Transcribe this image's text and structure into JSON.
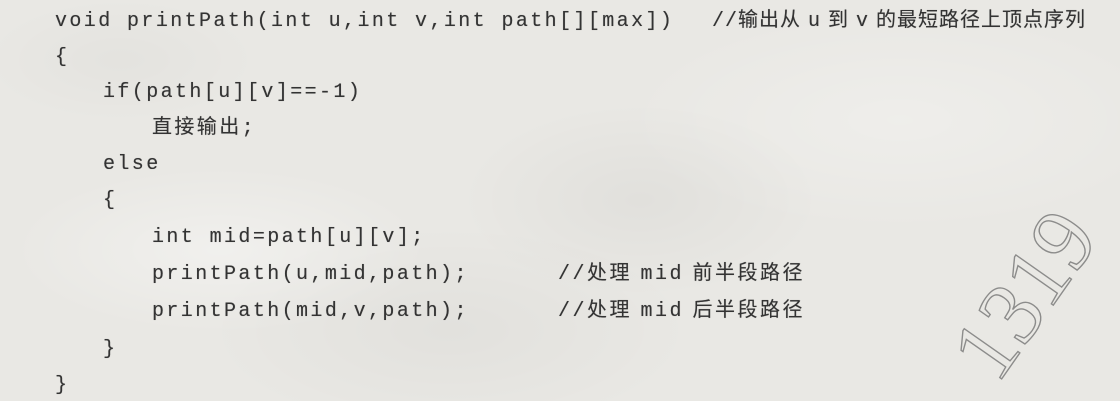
{
  "code_listing": {
    "lines": [
      {
        "code": "void printPath(int u,int v,int path[][max])",
        "comment": "//输出从 u 到 v 的最短路径上顶点序列"
      },
      {
        "code": "{"
      },
      {
        "code": "if(path[u][v]==-1)"
      },
      {
        "code": "直接输出;"
      },
      {
        "code": "else"
      },
      {
        "code": "{"
      },
      {
        "code": "int mid=path[u][v];"
      },
      {
        "code": "printPath(u,mid,path);",
        "comment": "//处理 mid 前半段路径"
      },
      {
        "code": "printPath(mid,v,path);",
        "comment": "//处理 mid 后半段路径"
      },
      {
        "code": "}"
      },
      {
        "code": "}"
      }
    ]
  },
  "watermark": {
    "text": "1319"
  },
  "colors": {
    "paper": "#e9e8e4",
    "ink": "#333333",
    "watermark_stroke": "#6e6e6e"
  }
}
